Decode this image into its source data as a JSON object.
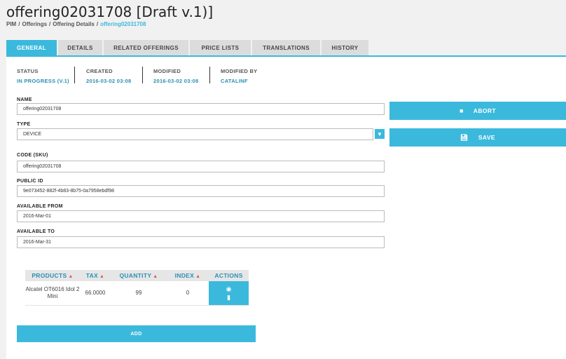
{
  "page": {
    "title": "offering02031708 [Draft v.1)]",
    "breadcrumb": [
      "PIM",
      "Offerings",
      "Offering Details",
      "offering02031708"
    ]
  },
  "tabs": [
    {
      "label": "GENERAL",
      "active": true
    },
    {
      "label": "DETAILS",
      "active": false
    },
    {
      "label": "RELATED OFFERINGS",
      "active": false
    },
    {
      "label": "PRICE LISTS",
      "active": false
    },
    {
      "label": "TRANSLATIONS",
      "active": false
    },
    {
      "label": "HISTORY",
      "active": false
    }
  ],
  "meta": [
    {
      "label": "STATUS",
      "value": "IN PROGRESS (V.1)"
    },
    {
      "label": "CREATED",
      "value": "2016-03-02 03:08"
    },
    {
      "label": "MODIFIED",
      "value": "2016-03-02 03:08"
    },
    {
      "label": "MODIFIED BY",
      "value": "CATALINF"
    }
  ],
  "form": {
    "name": {
      "label": "NAME",
      "value": "offering02031708"
    },
    "type": {
      "label": "TYPE",
      "value": "DEVICE"
    },
    "code": {
      "label": "CODE (SKU)",
      "value": "offering02031708"
    },
    "public_id": {
      "label": "PUBLIC ID",
      "value": "9e073452-882f-4b83-8b75-0a7958ebdf98"
    },
    "available_from": {
      "label": "AVAILABLE FROM",
      "value": "2016-Mar-01"
    },
    "available_to": {
      "label": "AVAILABLE TO",
      "value": "2016-Mar-31"
    }
  },
  "buttons": {
    "abort": "ABORT",
    "save": "SAVE",
    "add": "ADD"
  },
  "products_table": {
    "headers": [
      "PRODUCTS",
      "TAX",
      "QUANTITY",
      "INDEX",
      "ACTIONS"
    ],
    "rows": [
      {
        "product": "Alcatel OT6016 Idol 2 Mini",
        "tax": "66.0000",
        "quantity": "99",
        "index": "0"
      }
    ]
  },
  "icons": {
    "abort": "stop-icon",
    "save": "floppy-disk-icon",
    "select": "chevron-down-icon",
    "view": "eye-icon",
    "delete": "trash-icon",
    "sort": "sort-arrows-icon"
  },
  "colors": {
    "accent": "#3bb9dc",
    "link": "#2a8fb3",
    "sort_arrow": "#e05a5a"
  }
}
